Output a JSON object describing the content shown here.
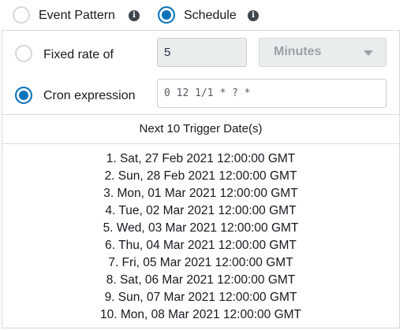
{
  "source_type": {
    "event_pattern_label": "Event Pattern",
    "schedule_label": "Schedule",
    "selected": "Schedule"
  },
  "schedule": {
    "fixed_rate_label": "Fixed rate of",
    "rate_value": "5",
    "rate_unit": "Minutes",
    "cron_label": "Cron expression",
    "cron_value": "0 12 1/1 * ? *",
    "selected": "Cron expression"
  },
  "trigger_dates": {
    "title": "Next 10 Trigger Date(s)",
    "items": [
      "1. Sat, 27 Feb 2021 12:00:00 GMT",
      "2. Sun, 28 Feb 2021 12:00:00 GMT",
      "3. Mon, 01 Mar 2021 12:00:00 GMT",
      "4. Tue, 02 Mar 2021 12:00:00 GMT",
      "5. Wed, 03 Mar 2021 12:00:00 GMT",
      "6. Thu, 04 Mar 2021 12:00:00 GMT",
      "7. Fri, 05 Mar 2021 12:00:00 GMT",
      "8. Sat, 06 Mar 2021 12:00:00 GMT",
      "9. Sun, 07 Mar 2021 12:00:00 GMT",
      "10. Mon, 08 Mar 2021 12:00:00 GMT"
    ]
  },
  "icons": {
    "info": "info-icon",
    "dropdown": "chevron-down-icon"
  },
  "colors": {
    "radio_selected": "#0a73bb",
    "radio_unselected_border": "#d3d7db",
    "disabled_fill": "#eaeded"
  }
}
